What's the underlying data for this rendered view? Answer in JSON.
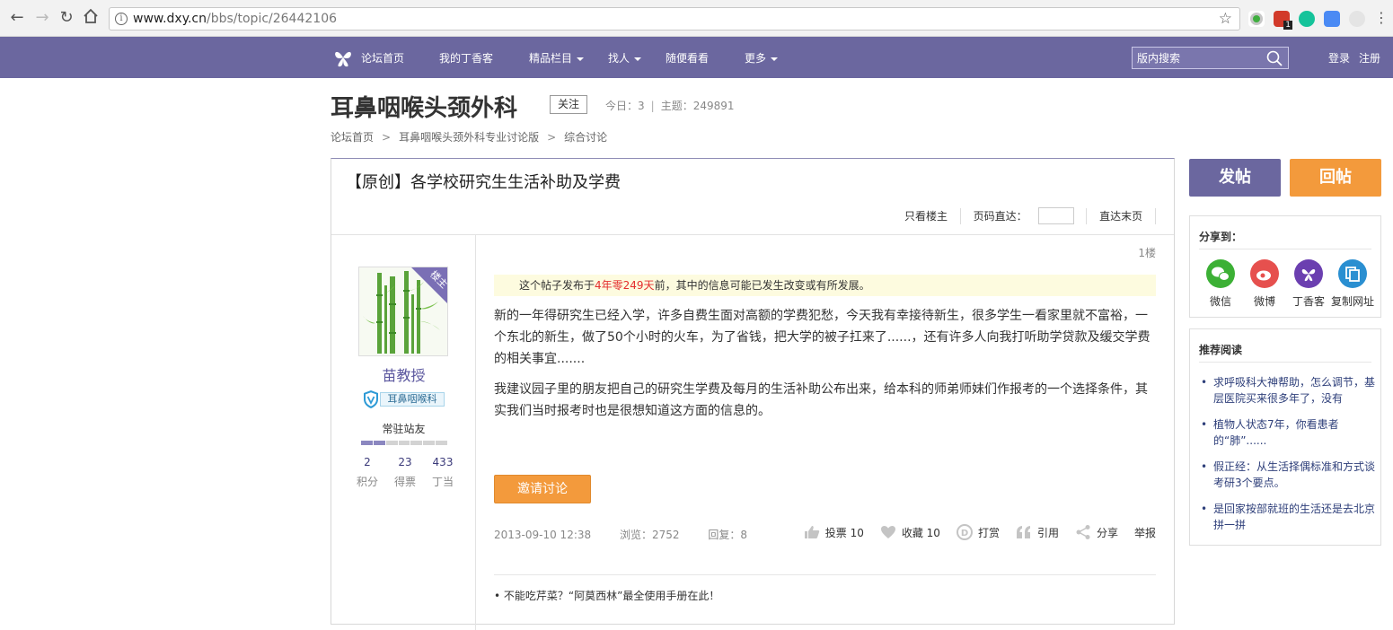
{
  "browser": {
    "url_host": "www.dxy.cn",
    "url_path": "/bbs/topic/26442106",
    "ext_badge": "1"
  },
  "site_nav": {
    "items": [
      {
        "label": "论坛首页",
        "caret": false
      },
      {
        "label": "我的丁香客",
        "caret": false
      },
      {
        "label": "精品栏目",
        "caret": true
      },
      {
        "label": "找人",
        "caret": true
      },
      {
        "label": "随便看看",
        "caret": false
      },
      {
        "label": "更多",
        "caret": true
      }
    ],
    "search_placeholder": "版内搜索",
    "login": "登录",
    "register": "注册",
    "color": "#6b679f"
  },
  "forum": {
    "title": "耳鼻咽喉头颈外科",
    "follow": "关注",
    "today": "今日：3",
    "topics": "主题：249891"
  },
  "breadcrumb": [
    "论坛首页",
    "耳鼻咽喉头颈外科专业讨论版",
    "综合讨论"
  ],
  "thread": {
    "title": "【原创】各学校研究生生活补助及学费",
    "tool_only_op": "只看楼主",
    "tool_page_jump": "页码直达：",
    "tool_last_page": "直达末页"
  },
  "author": {
    "badge": "楼主",
    "name": "苗教授",
    "dept": "耳鼻咽喉科",
    "rank": "常驻站友",
    "rank_level": 2,
    "rank_total": 7,
    "stats": [
      {
        "num": "2",
        "label": "积分"
      },
      {
        "num": "23",
        "label": "得票"
      },
      {
        "num": "433",
        "label": "丁当"
      }
    ]
  },
  "post": {
    "floor": "1楼",
    "notice_pre": "这个帖子发布于",
    "notice_age": "4年零249天",
    "notice_post": "前，其中的信息可能已发生改变或有所发展。",
    "para1": "新的一年得研究生已经入学，许多自费生面对高额的学费犯愁，今天我有幸接待新生，很多学生一看家里就不富裕，一个东北的新生，做了50个小时的火车，为了省钱，把大学的被子扛来了......，还有许多人向我打听助学贷款及缓交学费的相关事宜.......",
    "para2": "我建议园子里的朋友把自己的研究生学费及每月的生活补助公布出来，给本科的师弟师妹们作报考的一个选择条件，其实我们当时报考时也是很想知道这方面的信息的。",
    "invite": "邀请讨论",
    "date": "2013-09-10 12:38",
    "views": "浏览：2752",
    "replies": "回复：8",
    "vote": "投票 10",
    "fav": "收藏 10",
    "tip": "打赏",
    "quote": "引用",
    "share": "分享",
    "report": "举报",
    "related": "• 不能吃芹菜？“阿莫西林”最全使用手册在此！"
  },
  "sidebar": {
    "post_btn": "发帖",
    "reply_btn": "回帖",
    "share_title": "分享到：",
    "share_items": [
      {
        "label": "微信",
        "color": "#3cb035",
        "icon": "wechat-icon"
      },
      {
        "label": "微博",
        "color": "#e6504e",
        "icon": "weibo-icon"
      },
      {
        "label": "丁香客",
        "color": "#6b3fb0",
        "icon": "dxy-icon"
      },
      {
        "label": "复制网址",
        "color": "#2a8fd1",
        "icon": "copy-icon"
      }
    ],
    "read_title": "推荐阅读",
    "read_items": [
      "求呼吸科大神帮助，怎么调节，基层医院买来很多年了，没有",
      "植物人状态7年，你看患者的“肺”......",
      "假正经：从生活择偶标准和方式谈考研3个要点。",
      "是回家按部就班的生活还是去北京拼一拼"
    ]
  }
}
